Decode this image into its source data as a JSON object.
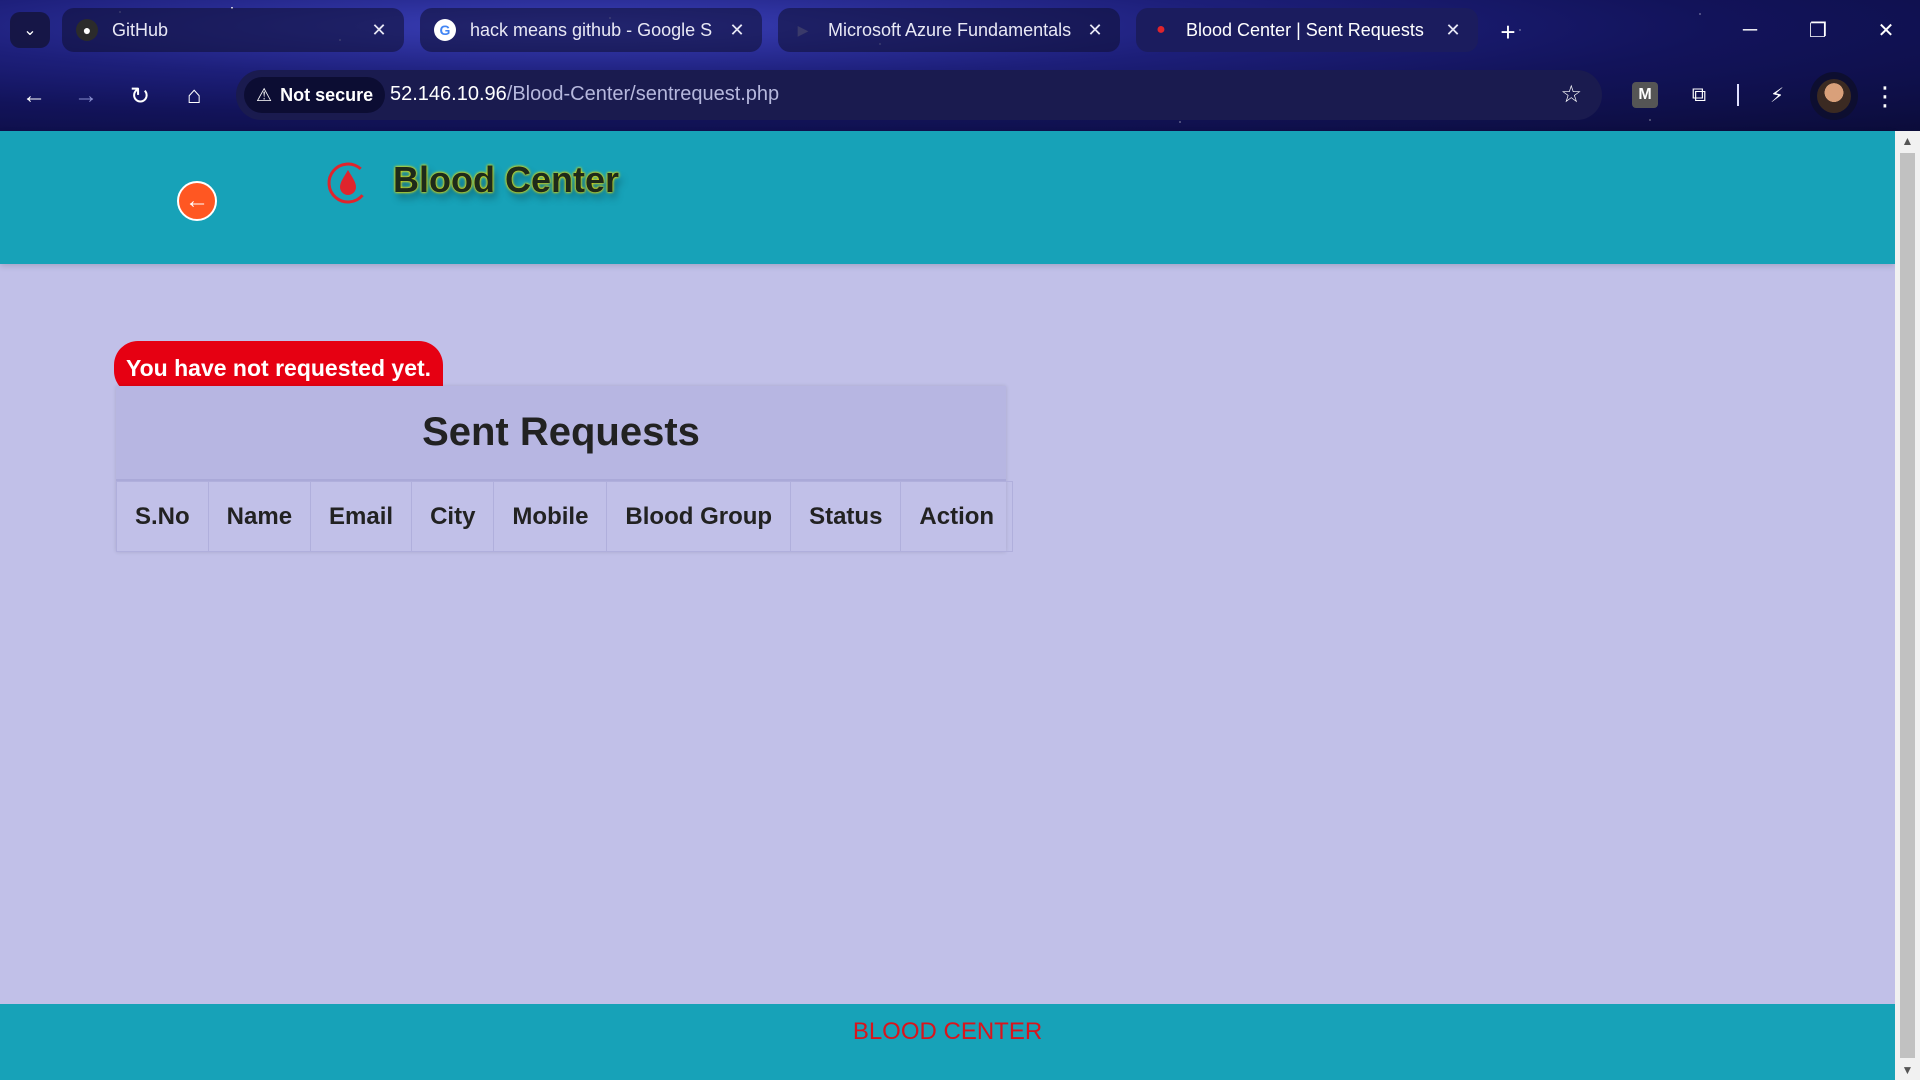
{
  "browser": {
    "tabs": [
      {
        "title": "GitHub",
        "favicon": "github-icon"
      },
      {
        "title": "hack means github - Google S",
        "favicon": "google-icon"
      },
      {
        "title": "Microsoft Azure Fundamentals",
        "favicon": "azure-video-icon"
      },
      {
        "title": "Blood Center | Sent Requests",
        "favicon": "blood-drop-icon"
      }
    ],
    "security_label": "Not secure",
    "url_host": "52.146.10.96",
    "url_path": "/Blood-Center/sentrequest.php"
  },
  "header": {
    "brand": "Blood Center"
  },
  "alert": {
    "message": "You have not requested yet."
  },
  "requests": {
    "title": "Sent Requests",
    "columns": [
      "S.No",
      "Name",
      "Email",
      "City",
      "Mobile",
      "Blood Group",
      "Status",
      "Action"
    ],
    "rows": []
  },
  "footer": {
    "text": "BLOOD CENTER"
  },
  "colors": {
    "page_bg": "#c1c0e8",
    "header_bg": "#17a2b8",
    "alert_bg": "#e60012",
    "back_button": "#ff5722",
    "footer_text": "#d9141c"
  }
}
